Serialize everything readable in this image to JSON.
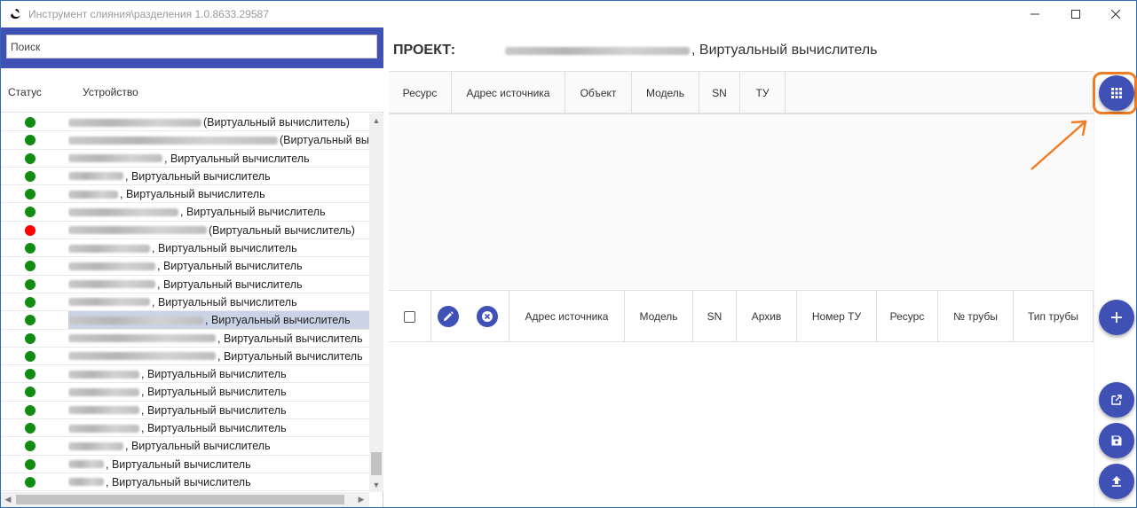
{
  "window": {
    "title": "Инструмент слияния\\разделения 1.0.8633.29587",
    "minimize_glyph": "—",
    "maximize_glyph": "☐",
    "close_glyph": "✕"
  },
  "search": {
    "placeholder": "Поиск",
    "value": ""
  },
  "device_list": {
    "headers": {
      "status": "Статус",
      "device": "Устройство"
    },
    "rows": [
      {
        "status": "red-free",
        "color": "green",
        "blur_width": 150,
        "suffix": "(Виртуальный вычислитель)"
      },
      {
        "color": "green",
        "blur_width": 236,
        "suffix": "(Виртуальный вы"
      },
      {
        "color": "green",
        "blur_width": 106,
        "suffix": ", Виртуальный вычислитель"
      },
      {
        "color": "green",
        "blur_width": 62,
        "suffix": ", Виртуальный вычислитель"
      },
      {
        "color": "green",
        "blur_width": 56,
        "suffix": ", Виртуальный вычислитель"
      },
      {
        "color": "green",
        "blur_width": 124,
        "suffix": ", Виртуальный вычислитель"
      },
      {
        "color": "red",
        "blur_width": 156,
        "suffix": "(Виртуальный вычислитель)"
      },
      {
        "color": "green",
        "blur_width": 92,
        "suffix": ", Виртуальный вычислитель"
      },
      {
        "color": "green",
        "blur_width": 98,
        "suffix": ", Виртуальный вычислитель"
      },
      {
        "color": "green",
        "blur_width": 98,
        "suffix": ", Виртуальный вычислитель"
      },
      {
        "color": "green",
        "blur_width": 92,
        "suffix": ", Виртуальный вычислитель"
      },
      {
        "color": "green",
        "blur_width": 152,
        "suffix": ", Виртуальный вычислитель",
        "selected": true
      },
      {
        "color": "green",
        "blur_width": 166,
        "suffix": ", Виртуальный вычислитель"
      },
      {
        "color": "green",
        "blur_width": 166,
        "suffix": ", Виртуальный вычислитель"
      },
      {
        "color": "green",
        "blur_width": 80,
        "suffix": ", Виртуальный вычислитель"
      },
      {
        "color": "green",
        "blur_width": 80,
        "suffix": ", Виртуальный вычислитель"
      },
      {
        "color": "green",
        "blur_width": 80,
        "suffix": ", Виртуальный вычислитель"
      },
      {
        "color": "green",
        "blur_width": 80,
        "suffix": ", Виртуальный вычислитель"
      },
      {
        "color": "green",
        "blur_width": 62,
        "suffix": ", Виртуальный вычислитель"
      },
      {
        "color": "green",
        "blur_width": 40,
        "suffix": ", Виртуальный вычислитель"
      },
      {
        "color": "green",
        "blur_width": 40,
        "suffix": ", Виртуальный вычислитель"
      }
    ]
  },
  "project": {
    "label": "ПРОЕКТ:",
    "name_suffix": ", Виртуальный вычислитель"
  },
  "upper_grid": {
    "columns": [
      "Ресурс",
      "Адрес источника",
      "Объект",
      "Модель",
      "SN",
      "ТУ"
    ]
  },
  "lower_grid": {
    "columns": [
      "Адрес источника",
      "Модель",
      "SN",
      "Архив",
      "Номер ТУ",
      "Ресурс",
      "№ трубы",
      "Тип трубы"
    ]
  },
  "colors": {
    "accent": "#3f51b5",
    "highlight": "#f27c22",
    "status_ok": "#118c11",
    "status_error": "#ff0000",
    "selection": "#cbd3e6"
  },
  "icons": {
    "columns_button": "apps-grid-icon",
    "edit": "pencil-icon",
    "remove": "close-circle-icon",
    "add": "plus-icon",
    "open_external": "open-in-new-icon",
    "save": "save-icon",
    "upload": "upload-icon"
  }
}
